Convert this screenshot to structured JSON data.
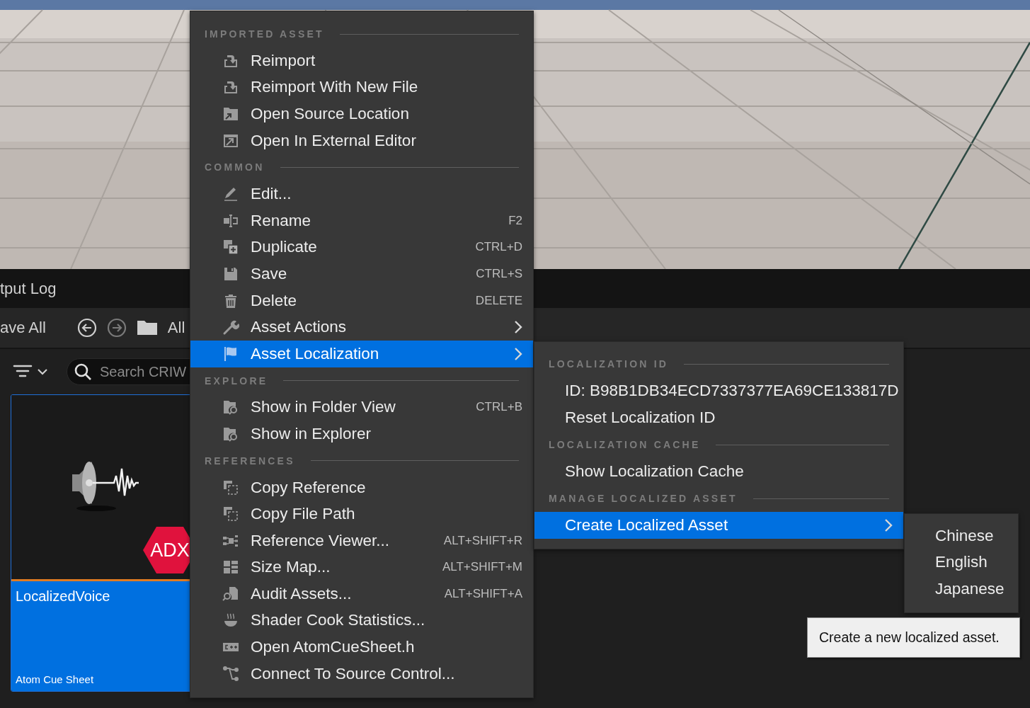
{
  "panel_tab": {
    "title": "tput Log"
  },
  "toolbar": {
    "save_all": "ave All",
    "path": "All"
  },
  "search": {
    "placeholder": "Search CRIW"
  },
  "asset_card": {
    "name": "LocalizedVoice",
    "type": "Atom Cue Sheet",
    "badge": "ADX",
    "selected": true
  },
  "context_menu": {
    "sections": [
      {
        "heading": "IMPORTED ASSET",
        "items": [
          {
            "label": "Reimport",
            "selected": false,
            "submenu": false
          },
          {
            "label": "Reimport With New File",
            "selected": false,
            "submenu": false
          },
          {
            "label": "Open Source Location",
            "selected": false,
            "submenu": false
          },
          {
            "label": "Open In External Editor",
            "selected": false,
            "submenu": false
          }
        ]
      },
      {
        "heading": "COMMON",
        "items": [
          {
            "label": "Edit...",
            "selected": false,
            "submenu": false
          },
          {
            "label": "Rename",
            "shortcut": "F2",
            "selected": false,
            "submenu": false
          },
          {
            "label": "Duplicate",
            "shortcut": "CTRL+D",
            "selected": false,
            "submenu": false
          },
          {
            "label": "Save",
            "shortcut": "CTRL+S",
            "selected": false,
            "submenu": false
          },
          {
            "label": "Delete",
            "shortcut": "DELETE",
            "selected": false,
            "submenu": false
          },
          {
            "label": "Asset Actions",
            "selected": false,
            "submenu": true
          },
          {
            "label": "Asset Localization",
            "selected": true,
            "submenu": true
          }
        ]
      },
      {
        "heading": "EXPLORE",
        "items": [
          {
            "label": "Show in Folder View",
            "shortcut": "CTRL+B",
            "selected": false,
            "submenu": false
          },
          {
            "label": "Show in Explorer",
            "selected": false,
            "submenu": false
          }
        ]
      },
      {
        "heading": "REFERENCES",
        "items": [
          {
            "label": "Copy Reference",
            "selected": false,
            "submenu": false
          },
          {
            "label": "Copy File Path",
            "selected": false,
            "submenu": false
          },
          {
            "label": "Reference Viewer...",
            "shortcut": "ALT+SHIFT+R",
            "selected": false,
            "submenu": false
          },
          {
            "label": "Size Map...",
            "shortcut": "ALT+SHIFT+M",
            "selected": false,
            "submenu": false
          },
          {
            "label": "Audit Assets...",
            "shortcut": "ALT+SHIFT+A",
            "selected": false,
            "submenu": false
          },
          {
            "label": "Shader Cook Statistics...",
            "selected": false,
            "submenu": false
          },
          {
            "label": "Open AtomCueSheet.h",
            "selected": false,
            "submenu": false
          },
          {
            "label": "Connect To Source Control...",
            "selected": false,
            "submenu": false
          }
        ]
      }
    ]
  },
  "localization_menu": {
    "sections": [
      {
        "heading": "LOCALIZATION ID",
        "items": [
          {
            "label": "ID: B98B1DB34ECD7337377EA69CE133817D",
            "selected": false,
            "submenu": false
          },
          {
            "label": "Reset Localization ID",
            "selected": false,
            "submenu": false
          }
        ]
      },
      {
        "heading": "LOCALIZATION CACHE",
        "items": [
          {
            "label": "Show Localization Cache",
            "selected": false,
            "submenu": false
          }
        ]
      },
      {
        "heading": "MANAGE LOCALIZED ASSET",
        "items": [
          {
            "label": "Create Localized Asset",
            "selected": true,
            "submenu": true
          }
        ]
      }
    ]
  },
  "language_menu": {
    "items": [
      {
        "label": "Chinese",
        "selected": false
      },
      {
        "label": "English",
        "selected": false
      },
      {
        "label": "Japanese",
        "selected": false
      }
    ]
  },
  "tooltip": {
    "text": "Create a new localized asset."
  }
}
